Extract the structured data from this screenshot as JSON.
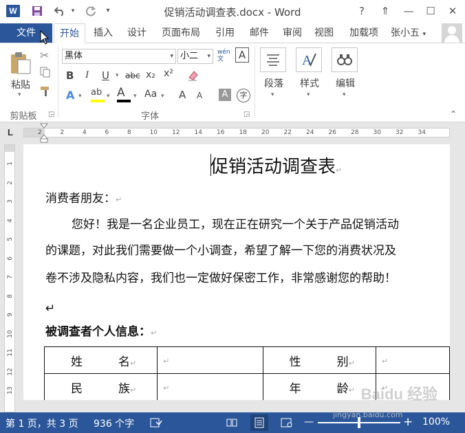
{
  "window": {
    "title": "促销活动调查表.docx - Word",
    "app_icon": "W",
    "controls": {
      "help": "?",
      "ribbon_display": "⇑",
      "minimize": "—",
      "maximize": "☐",
      "close": "✕"
    }
  },
  "quick_access": {
    "save_icon": "save-icon",
    "undo_icon": "undo-icon",
    "redo_icon": "redo-icon",
    "customize_icon": "customize-icon"
  },
  "tabs": [
    "文件",
    "开始",
    "插入",
    "设计",
    "页面布局",
    "引用",
    "邮件",
    "审阅",
    "视图",
    "加载项"
  ],
  "active_tab": "开始",
  "user": {
    "name": "张小五"
  },
  "ribbon": {
    "clipboard": {
      "paste_label": "粘贴",
      "group_label": "剪贴板"
    },
    "font": {
      "font_name": "黑体",
      "font_size": "小二",
      "phonetic": "wén 文",
      "char_border": "A",
      "bold": "B",
      "italic": "I",
      "underline": "U",
      "strikethrough": "abc",
      "subscript": "x₂",
      "superscript": "x²",
      "text_effects": "A",
      "highlight": "ab",
      "font_color": "A",
      "change_case": "Aa",
      "grow": "A",
      "shrink": "A",
      "char_shading": "A",
      "enclose": "字",
      "group_label": "字体"
    },
    "paragraph": {
      "label": "段落"
    },
    "styles": {
      "label": "样式"
    },
    "editing": {
      "label": "编辑"
    }
  },
  "ruler": {
    "corner": "L",
    "h_ticks": [
      "2",
      "2",
      "4",
      "6",
      "8",
      "10",
      "12",
      "14",
      "16",
      "18",
      "20",
      "22",
      "24",
      "26",
      "28",
      "30",
      "32",
      "34"
    ],
    "v_ticks": [
      "1",
      "2",
      "3",
      "4",
      "5",
      "6",
      "7",
      "8",
      "9",
      "10",
      "11",
      "12",
      "13"
    ]
  },
  "document": {
    "title": "促销活动调查表",
    "greeting": "消费者朋友：",
    "lines": [
      "您好！我是一名企业员工，现在正在研究一个关于产品促销活动",
      "的课题，对此我们需要做一个小调查，希望了解一下您的消费状况及",
      "卷不涉及隐私内容，我们也一定做好保密工作，非常感谢您的帮助！"
    ],
    "section_heading": "被调查者个人信息：",
    "table": [
      [
        [
          "姓",
          "名"
        ],
        [],
        [
          "性",
          "别"
        ],
        []
      ],
      [
        [
          "民",
          "族"
        ],
        [],
        [
          "年",
          "龄"
        ],
        []
      ]
    ],
    "para_mark": "↵"
  },
  "status_bar": {
    "page": "第 1 页，共 3 页",
    "words": "936 个字",
    "zoom_minus": "—",
    "zoom_plus": "+",
    "zoom_level": "100%",
    "zoom_fraction": 0.5
  },
  "watermark": {
    "logo": "Baidu 经验",
    "url": "jingyan.baidu.com"
  },
  "colors": {
    "accent": "#2b579a",
    "status_bar": "#2b579a",
    "ruler_bg": "#e6e6e6"
  }
}
